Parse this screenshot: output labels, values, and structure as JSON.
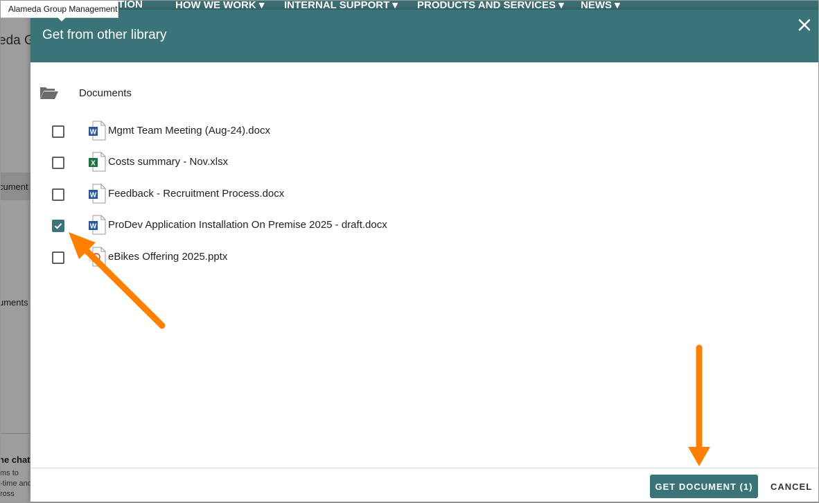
{
  "background": {
    "tooltip": "Alameda Group Management",
    "nav_items": [
      "TION",
      "HOW WE WORK",
      "INTERNAL SUPPORT",
      "PRODUCTS AND SERVICES",
      "NEWS"
    ],
    "site_title_fragment": "eda G",
    "side_text_1": "cument",
    "side_text_2": "uments",
    "chat_heading": "he chat",
    "chat_line_1": "ms to",
    "chat_line_2": "-time and",
    "chat_line_3": "ross"
  },
  "dialog": {
    "title": "Get from other library",
    "folder": {
      "label": "Documents",
      "icon": "folder-open-icon"
    },
    "files": [
      {
        "name": "Mgmt Team Meeting (Aug-24).docx",
        "type": "word",
        "checked": false
      },
      {
        "name": "Costs summary - Nov.xlsx",
        "type": "excel",
        "checked": false
      },
      {
        "name": "Feedback - Recruitment Process.docx",
        "type": "word",
        "checked": false
      },
      {
        "name": "ProDev Application Installation On Premise 2025 - draft.docx",
        "type": "word",
        "checked": true
      },
      {
        "name": "eBikes Offering 2025.pptx",
        "type": "powerpoint",
        "checked": false
      }
    ],
    "buttons": {
      "get": "GET DOCUMENT (1)",
      "cancel": "CANCEL"
    }
  },
  "colors": {
    "accent": "#3b7478",
    "annotation": "#ff8000",
    "word": "#2b5797",
    "excel": "#1e7145",
    "powerpoint": "#d24726"
  }
}
